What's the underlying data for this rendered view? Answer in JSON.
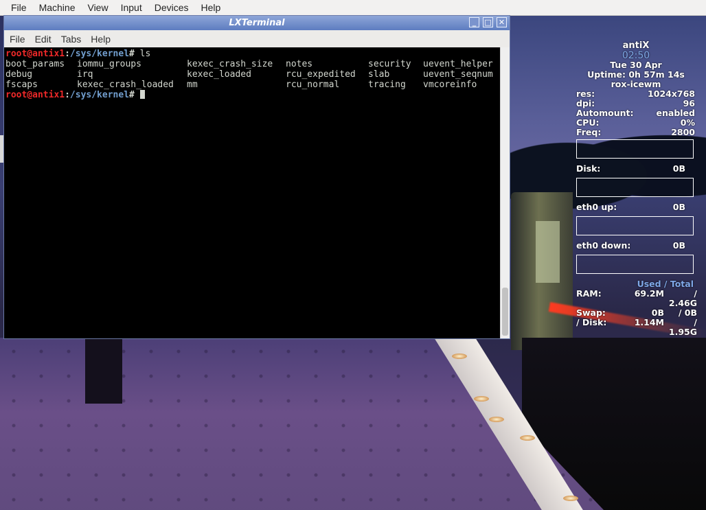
{
  "host_menu": [
    "File",
    "Machine",
    "View",
    "Input",
    "Devices",
    "Help"
  ],
  "window": {
    "title": "LXTerminal",
    "menu": [
      "File",
      "Edit",
      "Tabs",
      "Help"
    ],
    "controls": {
      "minimize": "_",
      "maximize": "□",
      "close": "✕"
    }
  },
  "terminal": {
    "prompt_user": "root@antix1",
    "prompt_sep": ":",
    "prompt_path": "/sys/kernel",
    "prompt_sym": "#",
    "command": " ls",
    "ls_output": [
      [
        "boot_params",
        "iommu_groups",
        "kexec_crash_size",
        "notes",
        "security",
        "uevent_helper"
      ],
      [
        "debug",
        "irq",
        "kexec_loaded",
        "rcu_expedited",
        "slab",
        "uevent_seqnum"
      ],
      [
        "fscaps",
        "kexec_crash_loaded",
        "mm",
        "rcu_normal",
        "tracing",
        "vmcoreinfo"
      ]
    ]
  },
  "conky": {
    "host": "antiX",
    "time": "02:50",
    "date": "Tue 30 Apr",
    "uptime": "Uptime: 0h 57m 14s",
    "wm": "rox-icewm",
    "stats": [
      {
        "label": "res:",
        "value": "1024x768"
      },
      {
        "label": "dpi:",
        "value": "96"
      },
      {
        "label": "Automount:",
        "value": "enabled"
      },
      {
        "label": "CPU:",
        "value": "0%"
      },
      {
        "label": "Freq:",
        "value": "2800"
      }
    ],
    "disk_label": "Disk:",
    "disk_value": "0B",
    "eth_up_label": "eth0 up:",
    "eth_up_value": "0B",
    "eth_down_label": "eth0 down:",
    "eth_down_value": "0B",
    "used_total": "Used / Total",
    "mem": [
      {
        "label": "RAM:",
        "used": "69.2M",
        "total": "/ 2.46G"
      },
      {
        "label": "Swap:",
        "used": "0B",
        "total": "/ 0B"
      },
      {
        "label": "/ Disk:",
        "used": "1.14M",
        "total": "/ 1.95G"
      }
    ]
  }
}
